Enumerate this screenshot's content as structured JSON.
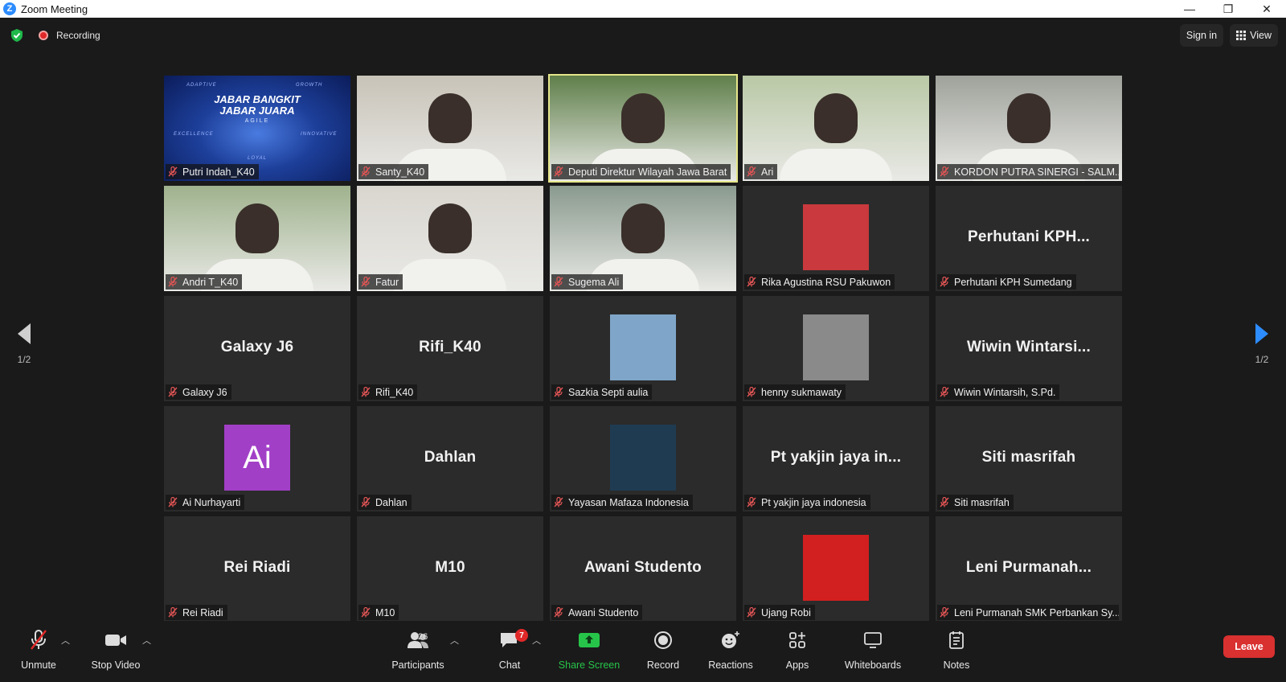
{
  "window": {
    "title": "Zoom Meeting",
    "app_letter": "Z",
    "minimize": "—",
    "restore": "❐",
    "close": "✕"
  },
  "topbar": {
    "recording": "Recording",
    "sign_in": "Sign in",
    "view": "View"
  },
  "pagination": {
    "left": "1/2",
    "right": "1/2"
  },
  "tiles": [
    {
      "label": "Putri Indah_K40",
      "video": "banner",
      "banner": {
        "line1": "JABAR BANGKIT",
        "line2": "JABAR JUARA",
        "line3": "AGILE",
        "words": [
          "ADAPTIVE",
          "GROWTH",
          "EXCELLENCE",
          "INNOVATIVE",
          "LOYAL"
        ]
      }
    },
    {
      "label": "Santy_K40",
      "video": "cam",
      "bg": "#c8c3b8"
    },
    {
      "label": "Deputi Direktur Wilayah Jawa Barat",
      "video": "cam",
      "bg": "#5f7f4a",
      "active": true
    },
    {
      "label": "Ari",
      "video": "cam",
      "bg": "#b9c8a5"
    },
    {
      "label": "KORDON PUTRA SINERGI - SALM...",
      "video": "cam",
      "bg": "#9fa29b"
    },
    {
      "label": "Andri T_K40",
      "video": "cam",
      "bg": "#9fb28d"
    },
    {
      "label": "Fatur",
      "video": "cam",
      "bg": "#d9d6cf"
    },
    {
      "label": "Sugema Ali",
      "video": "cam",
      "bg": "#8a9a8e"
    },
    {
      "label": "Rika Agustina RSU Pakuwon",
      "thumb": "#c9393d"
    },
    {
      "label": "Perhutani KPH Sumedang",
      "big": "Perhutani  KPH..."
    },
    {
      "label": "Galaxy J6",
      "big": "Galaxy J6"
    },
    {
      "label": "Rifi_K40",
      "big": "Rifi_K40"
    },
    {
      "label": "Sazkia Septi aulia",
      "thumb": "#7fa6c9"
    },
    {
      "label": "henny sukmawaty",
      "thumb": "#8a8a8a"
    },
    {
      "label": "Wiwin Wintarsih, S.Pd.",
      "big": "Wiwin  Wintarsi..."
    },
    {
      "label": "Ai Nurhayarti",
      "avatar_text": "Ai",
      "avatar_color": "#a23fc7"
    },
    {
      "label": "Dahlan",
      "big": "Dahlan"
    },
    {
      "label": "Yayasan Mafaza Indonesia",
      "thumb": "#1f3b52"
    },
    {
      "label": "Pt yakjin jaya indonesia",
      "big": "Pt yakjin jaya in..."
    },
    {
      "label": "Siti masrifah",
      "big": "Siti masrifah"
    },
    {
      "label": "Rei Riadi",
      "big": "Rei Riadi"
    },
    {
      "label": "M10",
      "big": "M10"
    },
    {
      "label": "Awani Studento",
      "big": "Awani Studento"
    },
    {
      "label": "Ujang Robi",
      "thumb": "#d21f1f"
    },
    {
      "label": "Leni Purmanah SMK Perbankan Sy...",
      "big": "Leni  Purmanah..."
    }
  ],
  "toolbar": {
    "unmute": "Unmute",
    "stop_video": "Stop Video",
    "participants": "Participants",
    "participants_count": "26",
    "chat": "Chat",
    "chat_badge": "7",
    "share_screen": "Share Screen",
    "record": "Record",
    "reactions": "Reactions",
    "apps": "Apps",
    "whiteboards": "Whiteboards",
    "notes": "Notes",
    "leave": "Leave"
  },
  "colors": {
    "accent": "#2d8cff",
    "leave": "#d93030",
    "share": "#27c44a",
    "active_speaker": "#e6e68a"
  }
}
